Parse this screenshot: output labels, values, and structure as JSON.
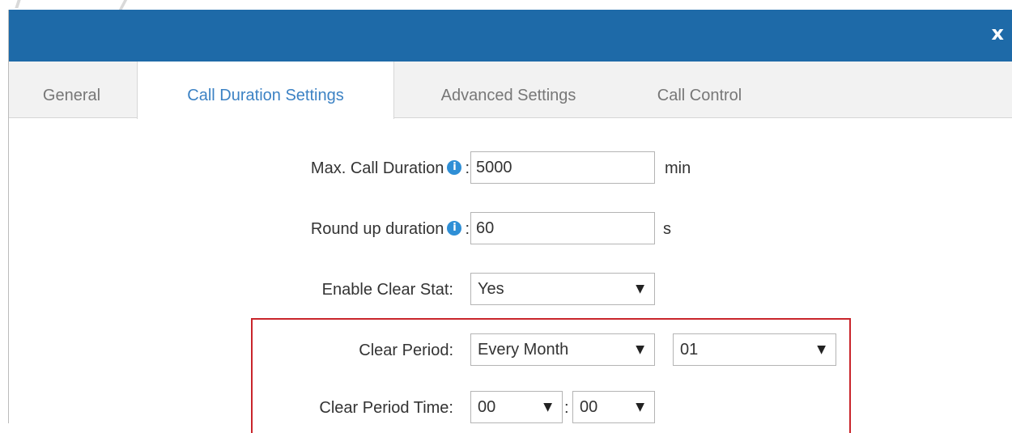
{
  "dialog": {
    "close_label": "x"
  },
  "tabs": [
    {
      "label": "General"
    },
    {
      "label": "Call Duration Settings"
    },
    {
      "label": "Advanced Settings"
    },
    {
      "label": "Call Control"
    }
  ],
  "form": {
    "max_call_duration": {
      "label": "Max. Call Duration",
      "suffix": ":",
      "value": "5000",
      "unit": "min",
      "info_icon": "i"
    },
    "round_up_duration": {
      "label": "Round up duration",
      "suffix": ":",
      "value": "60",
      "unit": "s",
      "info_icon": "i"
    },
    "enable_clear_stat": {
      "label": "Enable Clear Stat:",
      "value": "Yes"
    },
    "clear_period": {
      "label": "Clear Period:",
      "value": "Every Month",
      "day_value": "01"
    },
    "clear_period_time": {
      "label": "Clear Period Time:",
      "hour_value": "00",
      "separator": ":",
      "minute_value": "00"
    }
  },
  "icons": {
    "caret": "▼",
    "info": "info-icon"
  },
  "colors": {
    "titlebar": "#1e6aa8",
    "active_tab_text": "#3c82c4",
    "highlight_border": "#c9252b",
    "info_icon": "#2f8fd6"
  }
}
